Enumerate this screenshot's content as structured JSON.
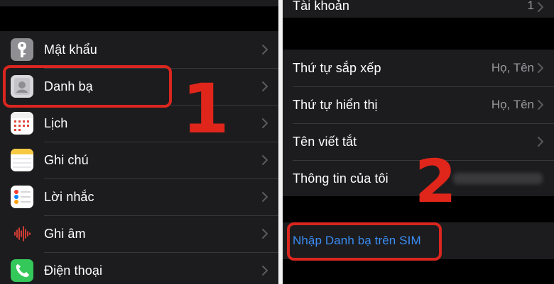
{
  "left": {
    "items": [
      {
        "label": "Mật khẩu",
        "icon": "key-icon"
      },
      {
        "label": "Danh bạ",
        "icon": "contacts-icon"
      },
      {
        "label": "Lịch",
        "icon": "calendar-icon"
      },
      {
        "label": "Ghi chú",
        "icon": "notes-icon"
      },
      {
        "label": "Lời nhắc",
        "icon": "reminders-icon"
      },
      {
        "label": "Ghi âm",
        "icon": "voice-memos-icon"
      },
      {
        "label": "Điện thoại",
        "icon": "phone-icon"
      }
    ]
  },
  "right": {
    "account": {
      "label": "Tài khoản",
      "value": "1"
    },
    "items": [
      {
        "label": "Thứ tự sắp xếp",
        "value": "Họ, Tên"
      },
      {
        "label": "Thứ tự hiển thị",
        "value": "Họ, Tên"
      },
      {
        "label": "Tên viết tắt",
        "value": ""
      },
      {
        "label": "Thông tin của tôi",
        "value": ""
      }
    ],
    "import_sim": "Nhập Danh bạ trên SIM"
  },
  "annotations": {
    "step1": "1",
    "step2": "2"
  },
  "colors": {
    "background": "#000000",
    "cell": "#1c1c1e",
    "link_blue": "#3a8df5",
    "highlight_red": "#d9261f"
  }
}
